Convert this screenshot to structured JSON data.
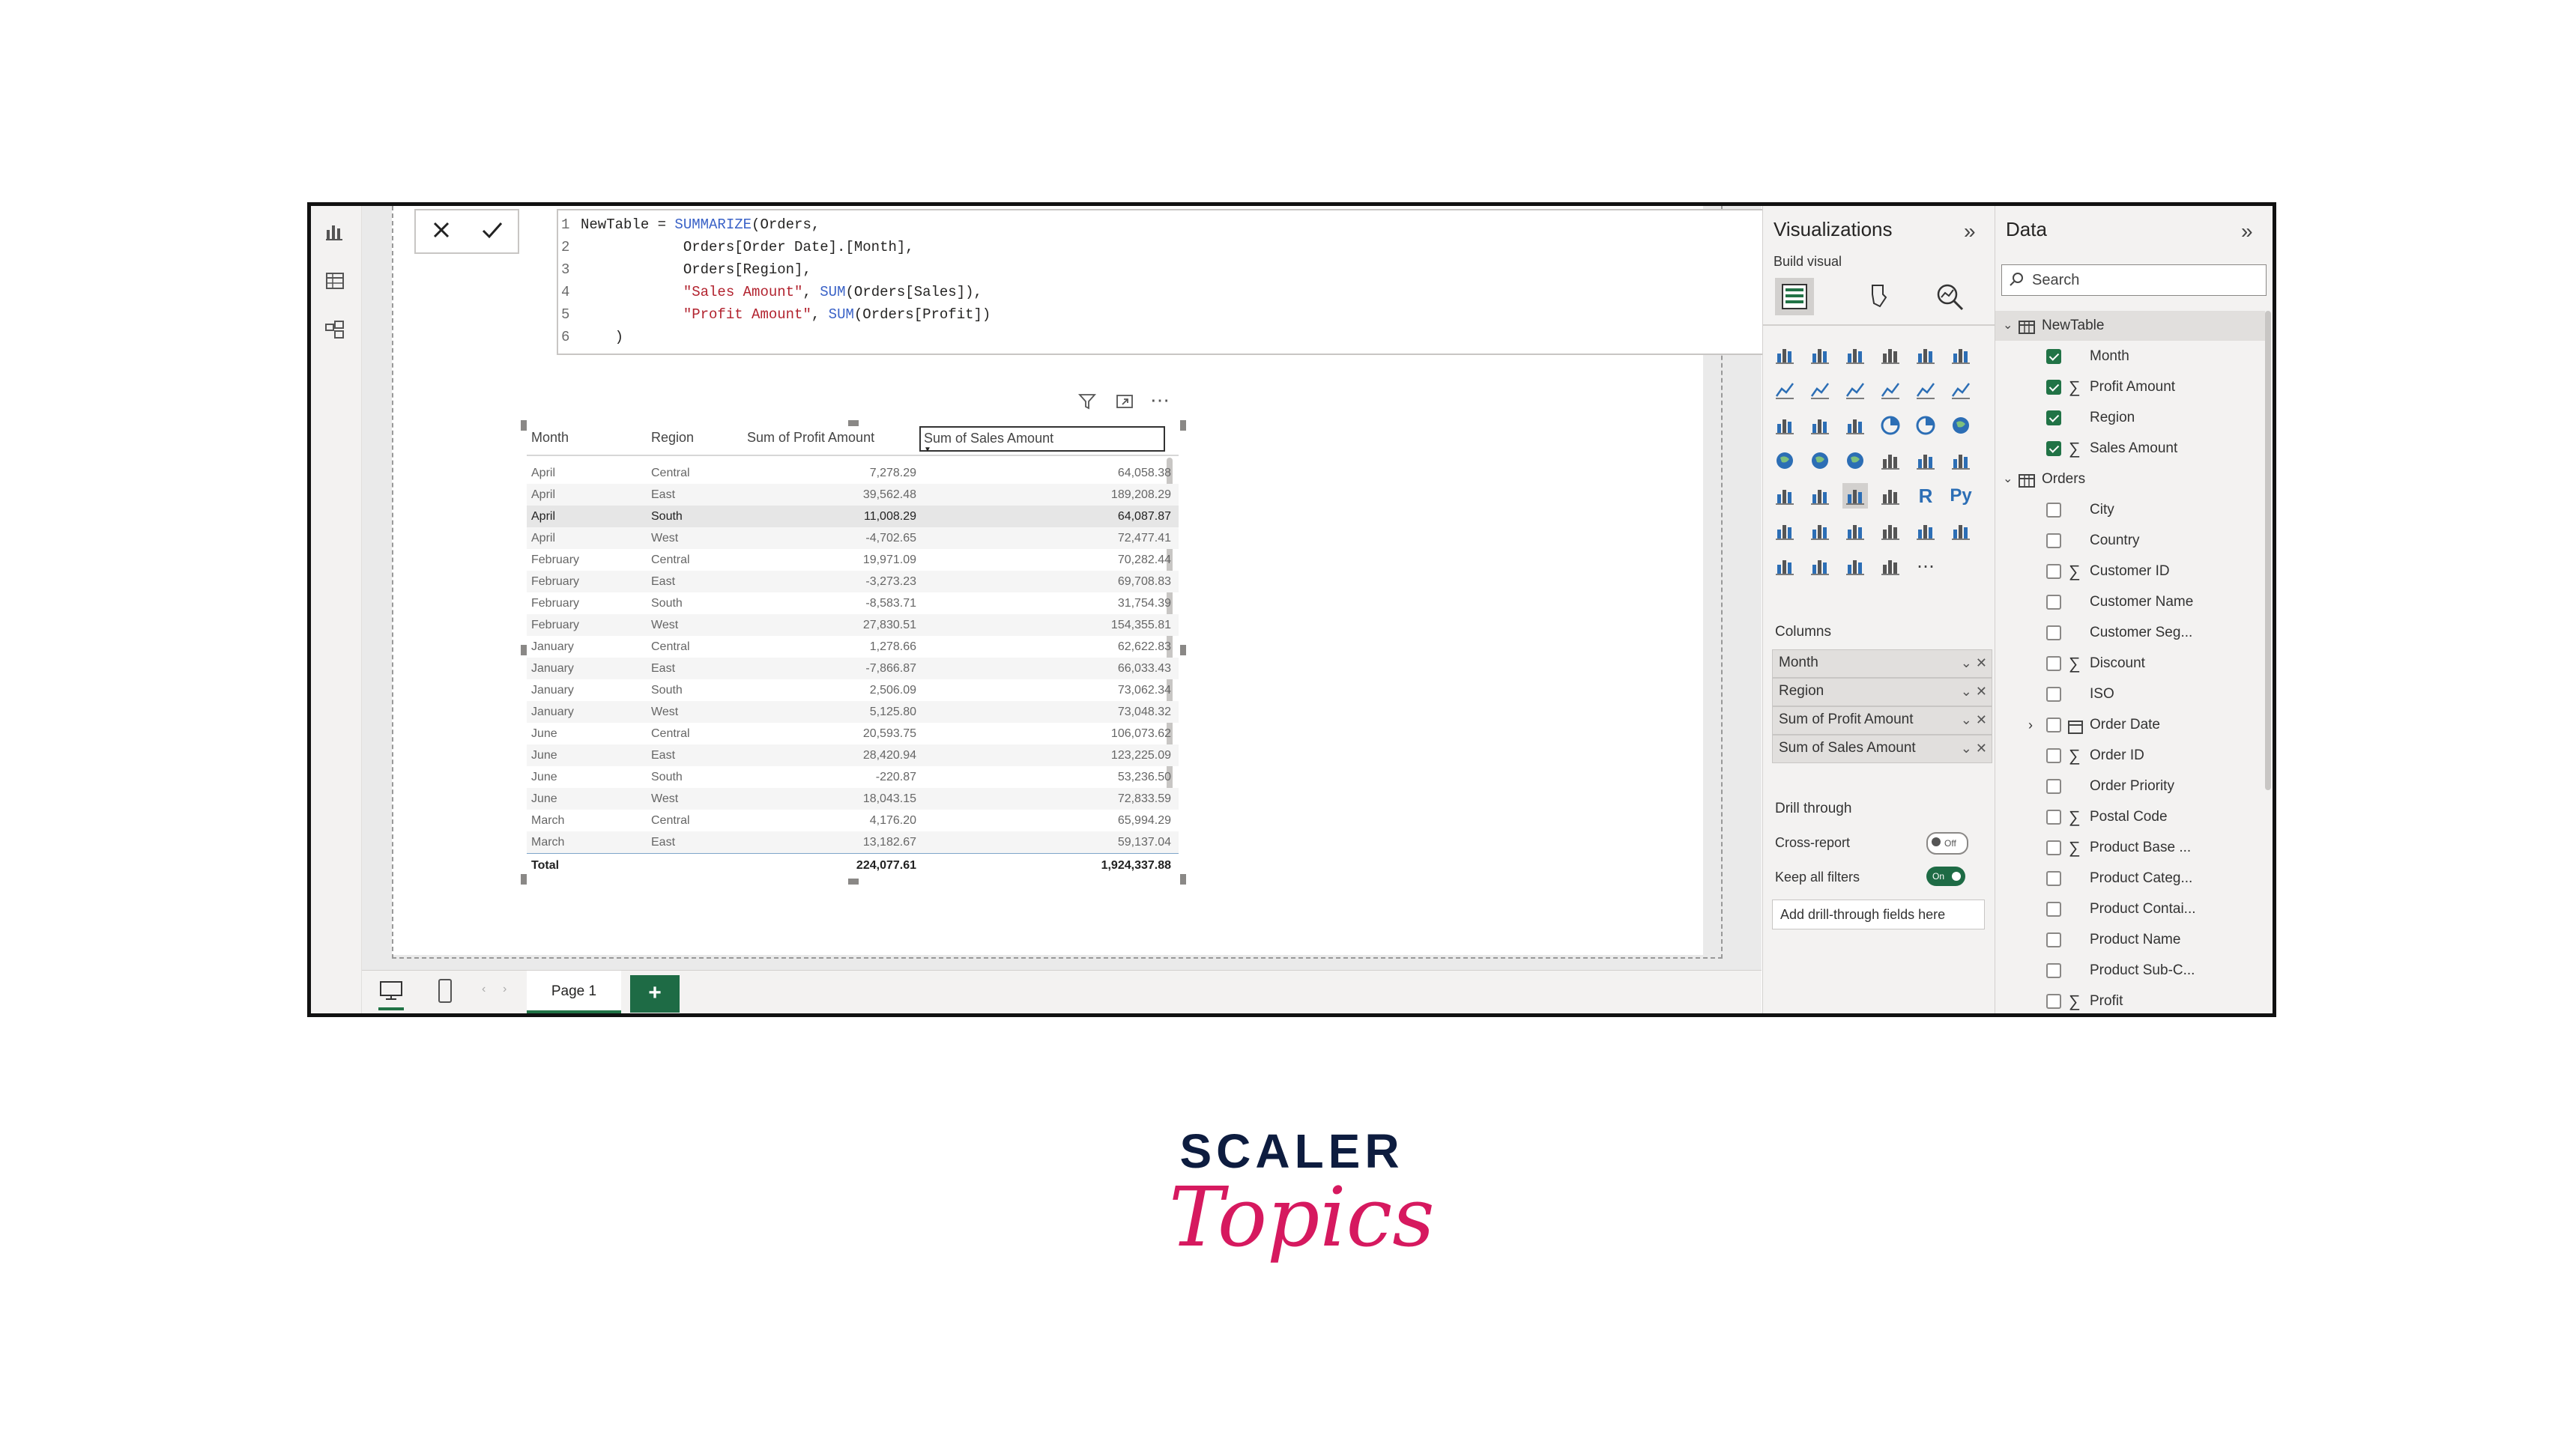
{
  "formula": {
    "lines": [
      {
        "n": "1",
        "parts": [
          [
            "plain",
            "NewTable = "
          ],
          [
            "fn",
            "SUMMARIZE"
          ],
          [
            "plain",
            "(Orders,"
          ]
        ]
      },
      {
        "n": "2",
        "parts": [
          [
            "plain",
            "            Orders[Order Date].[Month],"
          ]
        ]
      },
      {
        "n": "3",
        "parts": [
          [
            "plain",
            "            Orders[Region],"
          ]
        ]
      },
      {
        "n": "4",
        "parts": [
          [
            "str",
            "            \"Sales Amount\""
          ],
          [
            "plain",
            ", "
          ],
          [
            "fn",
            "SUM"
          ],
          [
            "plain",
            "(Orders[Sales]),"
          ]
        ]
      },
      {
        "n": "5",
        "parts": [
          [
            "str",
            "            \"Profit Amount\""
          ],
          [
            "plain",
            ", "
          ],
          [
            "fn",
            "SUM"
          ],
          [
            "plain",
            "(Orders[Profit])"
          ]
        ]
      },
      {
        "n": "6",
        "parts": [
          [
            "plain",
            "    )"
          ]
        ]
      }
    ]
  },
  "table": {
    "headers": [
      "Month",
      "Region",
      "Sum of Profit Amount",
      "Sum of Sales Amount"
    ],
    "rows": [
      [
        "April",
        "Central",
        "7,278.29",
        "64,058.38"
      ],
      [
        "April",
        "East",
        "39,562.48",
        "189,208.29"
      ],
      [
        "April",
        "South",
        "11,008.29",
        "64,087.87"
      ],
      [
        "April",
        "West",
        "-4,702.65",
        "72,477.41"
      ],
      [
        "February",
        "Central",
        "19,971.09",
        "70,282.44"
      ],
      [
        "February",
        "East",
        "-3,273.23",
        "69,708.83"
      ],
      [
        "February",
        "South",
        "-8,583.71",
        "31,754.39"
      ],
      [
        "February",
        "West",
        "27,830.51",
        "154,355.81"
      ],
      [
        "January",
        "Central",
        "1,278.66",
        "62,622.83"
      ],
      [
        "January",
        "East",
        "-7,866.87",
        "66,033.43"
      ],
      [
        "January",
        "South",
        "2,506.09",
        "73,062.34"
      ],
      [
        "January",
        "West",
        "5,125.80",
        "73,048.32"
      ],
      [
        "June",
        "Central",
        "20,593.75",
        "106,073.62"
      ],
      [
        "June",
        "East",
        "28,420.94",
        "123,225.09"
      ],
      [
        "June",
        "South",
        "-220.87",
        "53,236.50"
      ],
      [
        "June",
        "West",
        "18,043.15",
        "72,833.59"
      ],
      [
        "March",
        "Central",
        "4,176.20",
        "65,994.29"
      ],
      [
        "March",
        "East",
        "13,182.67",
        "59,137.04"
      ]
    ],
    "total": [
      "Total",
      "",
      "224,077.61",
      "1,924,337.88"
    ]
  },
  "viz": {
    "title": "Visualizations",
    "build_visual": "Build visual",
    "columns_label": "Columns",
    "wells": [
      "Month",
      "Region",
      "Sum of Profit Amount",
      "Sum of Sales Amount"
    ],
    "drill_through": "Drill through",
    "cross_report": "Cross-report",
    "cross_report_state": "Off",
    "keep_filters": "Keep all filters",
    "keep_filters_state": "On",
    "add_drill": "Add drill-through fields here"
  },
  "data": {
    "title": "Data",
    "search_placeholder": "Search",
    "tables": [
      {
        "name": "NewTable",
        "fields": [
          {
            "name": "Month",
            "sigma": false,
            "checked": true
          },
          {
            "name": "Profit Amount",
            "sigma": true,
            "checked": true
          },
          {
            "name": "Region",
            "sigma": false,
            "checked": true
          },
          {
            "name": "Sales Amount",
            "sigma": true,
            "checked": true
          }
        ]
      },
      {
        "name": "Orders",
        "fields": [
          {
            "name": "City",
            "sigma": false,
            "checked": false
          },
          {
            "name": "Country",
            "sigma": false,
            "checked": false
          },
          {
            "name": "Customer ID",
            "sigma": true,
            "checked": false
          },
          {
            "name": "Customer Name",
            "sigma": false,
            "checked": false
          },
          {
            "name": "Customer Seg...",
            "sigma": false,
            "checked": false
          },
          {
            "name": "Discount",
            "sigma": true,
            "checked": false
          },
          {
            "name": "ISO",
            "sigma": false,
            "checked": false
          },
          {
            "name": "Order Date",
            "sigma": false,
            "checked": false,
            "calendar": true
          },
          {
            "name": "Order ID",
            "sigma": true,
            "checked": false
          },
          {
            "name": "Order Priority",
            "sigma": false,
            "checked": false
          },
          {
            "name": "Postal Code",
            "sigma": true,
            "checked": false
          },
          {
            "name": "Product Base ...",
            "sigma": true,
            "checked": false
          },
          {
            "name": "Product Categ...",
            "sigma": false,
            "checked": false
          },
          {
            "name": "Product Contai...",
            "sigma": false,
            "checked": false
          },
          {
            "name": "Product Name",
            "sigma": false,
            "checked": false
          },
          {
            "name": "Product Sub-C...",
            "sigma": false,
            "checked": false
          },
          {
            "name": "Profit",
            "sigma": true,
            "checked": false
          }
        ]
      }
    ]
  },
  "bottom": {
    "page_tab": "Page 1",
    "add_page": "+"
  },
  "brand": {
    "line1": "SCALER",
    "line2": "Topics",
    "navy": "#0d1c3f",
    "pink": "#d6195f"
  }
}
